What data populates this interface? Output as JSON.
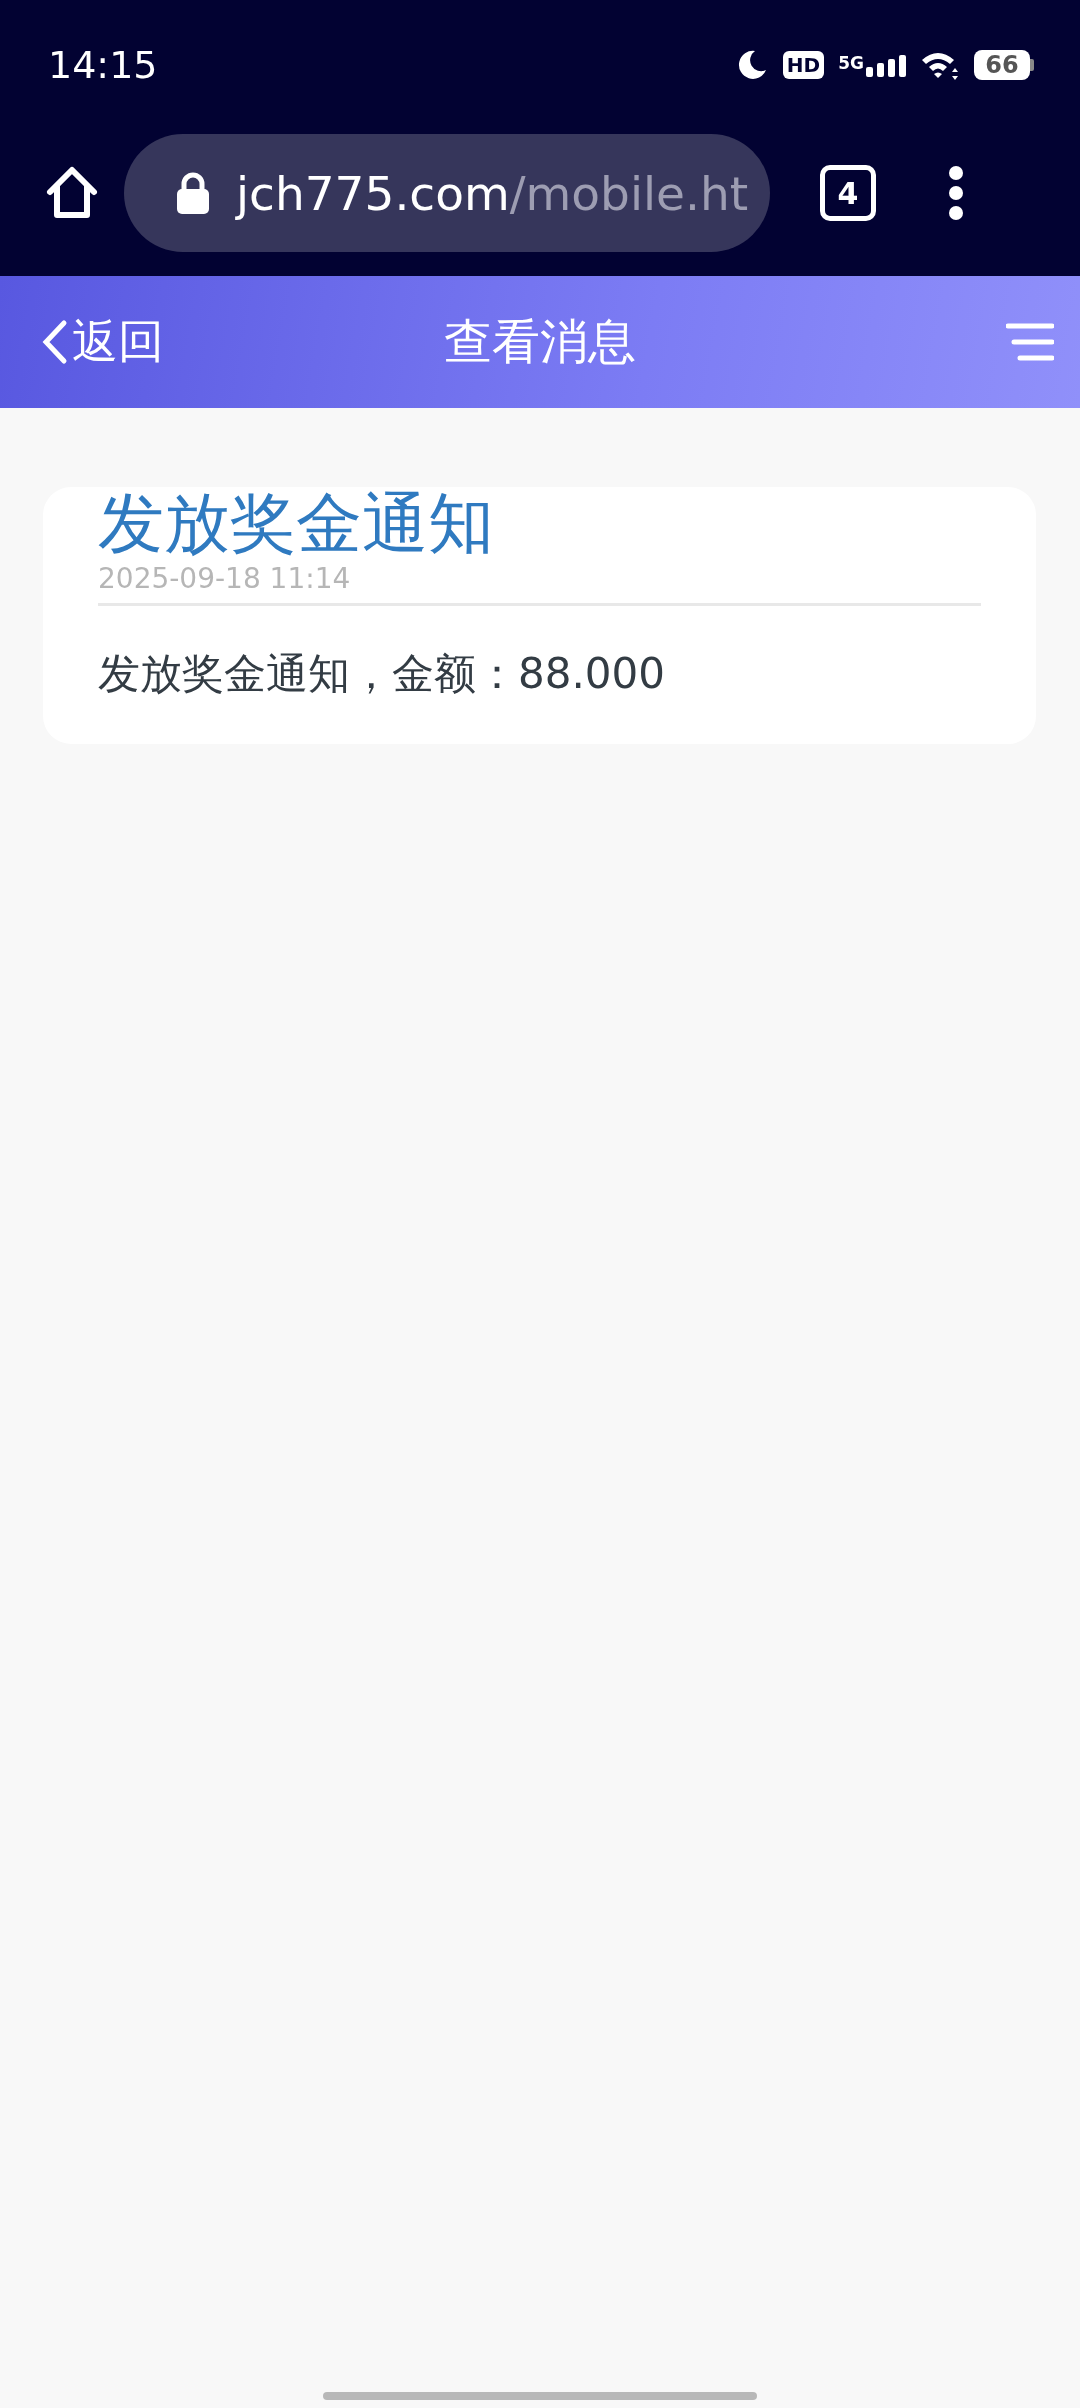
{
  "status_bar": {
    "time": "14:15",
    "hd": "HD",
    "network": "5G",
    "battery": "66"
  },
  "browser": {
    "url_domain": "jch775.com",
    "url_path": "/mobile.ht",
    "tab_count": "4"
  },
  "header": {
    "back": "返回",
    "title": "查看消息"
  },
  "message": {
    "title": "发放奖金通知",
    "date": "2025-09-18 11:14",
    "body": "发放奖金通知，金额：88.000"
  }
}
